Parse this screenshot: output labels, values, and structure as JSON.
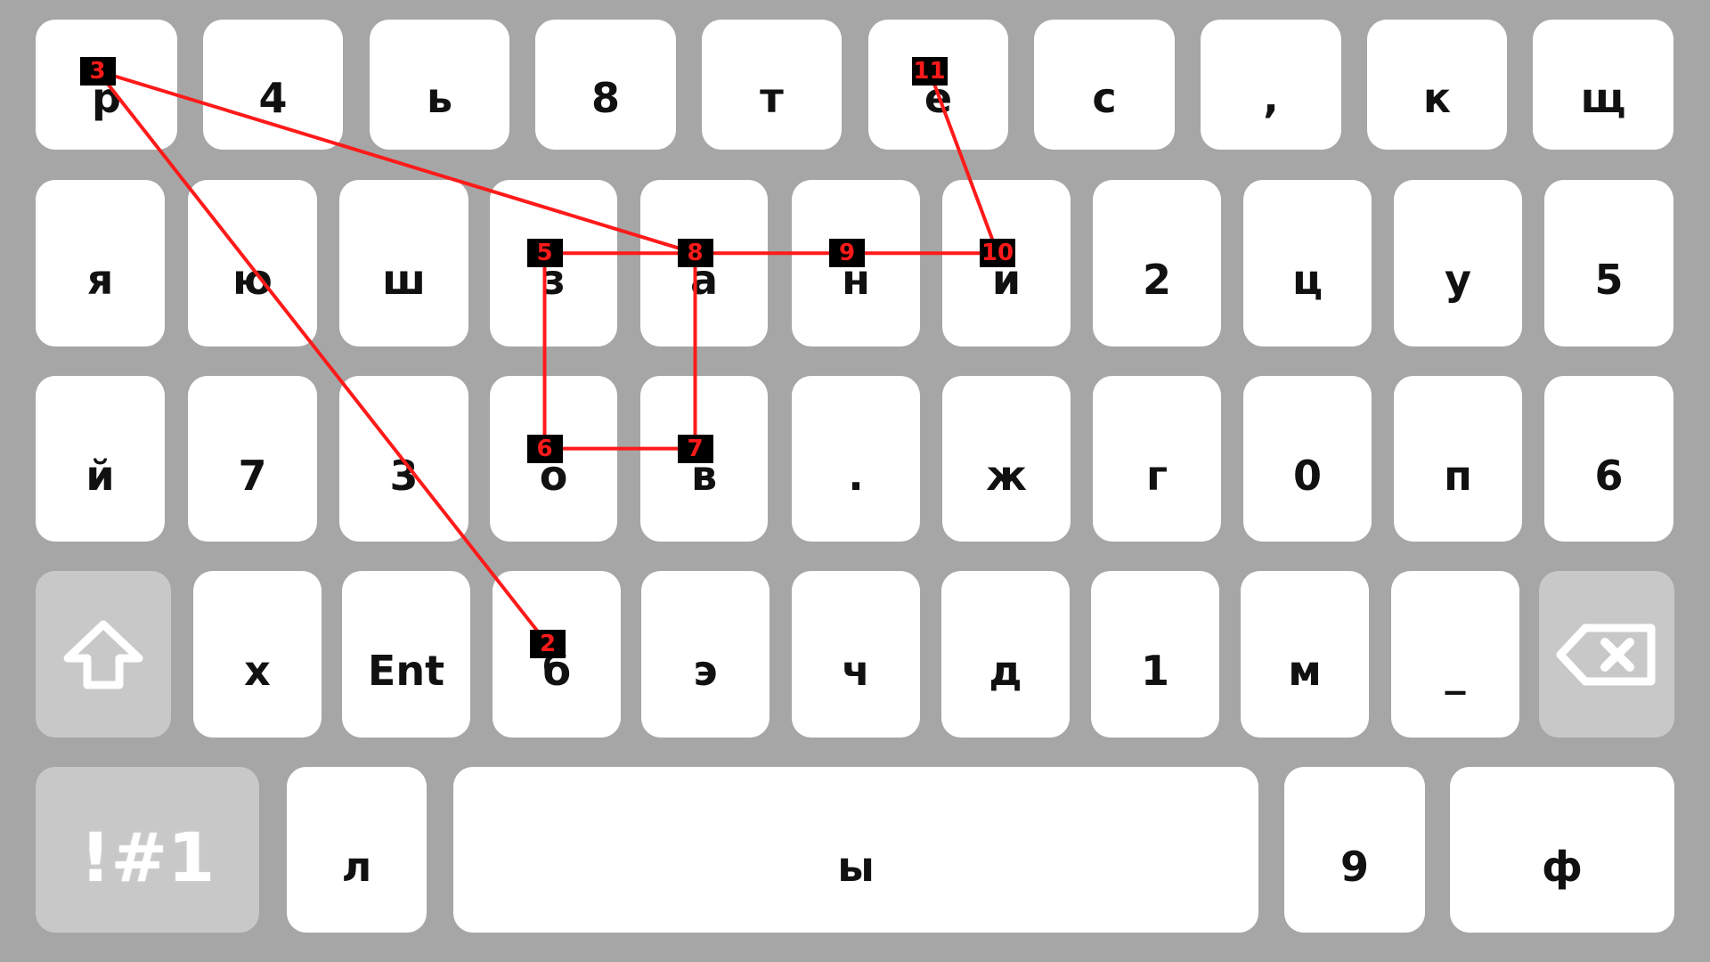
{
  "keyboard": {
    "rows": [
      [
        {
          "id": "r",
          "label": "р"
        },
        {
          "id": "4",
          "label": "4"
        },
        {
          "id": "soft",
          "label": "ь"
        },
        {
          "id": "8",
          "label": "8"
        },
        {
          "id": "t",
          "label": "т"
        },
        {
          "id": "e",
          "label": "е"
        },
        {
          "id": "s",
          "label": "с"
        },
        {
          "id": "comma",
          "label": ","
        },
        {
          "id": "k",
          "label": "к"
        },
        {
          "id": "shch",
          "label": "щ"
        }
      ],
      [
        {
          "id": "ya",
          "label": "я"
        },
        {
          "id": "yu",
          "label": "ю"
        },
        {
          "id": "sh",
          "label": "ш"
        },
        {
          "id": "z",
          "label": "з"
        },
        {
          "id": "a",
          "label": "а"
        },
        {
          "id": "n",
          "label": "н"
        },
        {
          "id": "i",
          "label": "и"
        },
        {
          "id": "2",
          "label": "2"
        },
        {
          "id": "ts",
          "label": "ц"
        },
        {
          "id": "u",
          "label": "у"
        },
        {
          "id": "5",
          "label": "5"
        }
      ],
      [
        {
          "id": "iy",
          "label": "й"
        },
        {
          "id": "7",
          "label": "7"
        },
        {
          "id": "3",
          "label": "3"
        },
        {
          "id": "o",
          "label": "о"
        },
        {
          "id": "v",
          "label": "в"
        },
        {
          "id": "period",
          "label": "."
        },
        {
          "id": "zh",
          "label": "ж"
        },
        {
          "id": "g",
          "label": "г"
        },
        {
          "id": "0",
          "label": "0"
        },
        {
          "id": "p",
          "label": "п"
        },
        {
          "id": "6",
          "label": "6"
        }
      ],
      [
        {
          "id": "shift",
          "label": "",
          "icon": "shift-icon",
          "func": true
        },
        {
          "id": "kh",
          "label": "х"
        },
        {
          "id": "enter",
          "label": "Ent"
        },
        {
          "id": "b",
          "label": "б"
        },
        {
          "id": "ee",
          "label": "э"
        },
        {
          "id": "ch",
          "label": "ч"
        },
        {
          "id": "d",
          "label": "д"
        },
        {
          "id": "1",
          "label": "1"
        },
        {
          "id": "m",
          "label": "м"
        },
        {
          "id": "underscore",
          "label": "_"
        },
        {
          "id": "backspace",
          "label": "",
          "icon": "backspace-icon",
          "func": true
        }
      ],
      [
        {
          "id": "symbols",
          "label": "!#1",
          "func": true
        },
        {
          "id": "l",
          "label": "л"
        },
        {
          "id": "space",
          "label": "ы"
        },
        {
          "id": "9",
          "label": "9"
        },
        {
          "id": "f",
          "label": "ф"
        }
      ]
    ]
  },
  "swipe_path": {
    "color": "#ff1a1a",
    "points": [
      {
        "label": "2",
        "key": "b"
      },
      {
        "label": "3",
        "key": "r"
      },
      {
        "label": "8",
        "key": "a"
      },
      {
        "label": "5",
        "key": "z"
      },
      {
        "label": "6",
        "key": "o"
      },
      {
        "label": "7",
        "key": "v"
      },
      {
        "label": "8",
        "key": "a"
      },
      {
        "label": "9",
        "key": "n"
      },
      {
        "label": "10",
        "key": "i"
      },
      {
        "label": "11",
        "key": "e"
      }
    ]
  }
}
